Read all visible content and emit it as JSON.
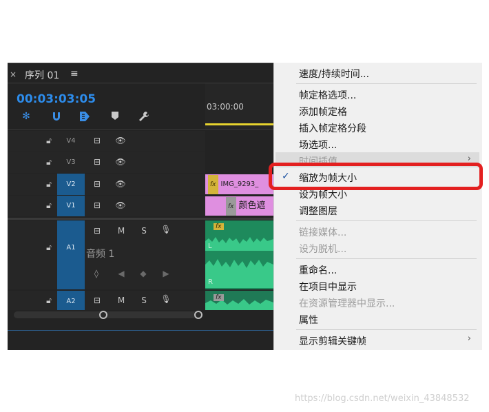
{
  "sequence": {
    "close_symbol": "×",
    "title": "序列 01",
    "menu_symbol": "≡",
    "timecode": "00:03:03:05",
    "ruler_time": "03:00:00"
  },
  "tracks": {
    "video": [
      {
        "label": "V4",
        "active": false
      },
      {
        "label": "V3",
        "active": false
      },
      {
        "label": "V2",
        "active": true
      },
      {
        "label": "V1",
        "active": true
      }
    ],
    "audio": [
      {
        "label": "A1",
        "name": "音频 1",
        "mute": "M",
        "solo": "S"
      },
      {
        "label": "A2",
        "mute": "M",
        "solo": "S"
      }
    ]
  },
  "clips": {
    "v2_fx": "fx",
    "v2_name": "IMG_9293_",
    "v1_fx": "fx",
    "v1_name": "颜色遮",
    "a1_fx": "fx",
    "a1_left": "L",
    "a1_right": "R",
    "a2_fx": "fx"
  },
  "menu": {
    "items": [
      {
        "label": "速度/持续时间...",
        "enabled": true
      },
      {
        "label": "帧定格选项...",
        "enabled": true
      },
      {
        "label": "添加帧定格",
        "enabled": true
      },
      {
        "label": "插入帧定格分段",
        "enabled": true
      },
      {
        "label": "场选项...",
        "enabled": true
      },
      {
        "label": "时间插值",
        "enabled": false,
        "submenu": true
      },
      {
        "label": "缩放为帧大小",
        "enabled": true,
        "checked": true
      },
      {
        "label": "设为帧大小",
        "enabled": true
      },
      {
        "label": "调整图层",
        "enabled": true
      },
      {
        "label": "链接媒体...",
        "enabled": false
      },
      {
        "label": "设为脱机...",
        "enabled": false
      },
      {
        "label": "重命名...",
        "enabled": true
      },
      {
        "label": "在项目中显示",
        "enabled": true
      },
      {
        "label": "在资源管理器中显示...",
        "enabled": false
      },
      {
        "label": "属性",
        "enabled": true
      },
      {
        "label": "显示剪辑关键帧",
        "enabled": true,
        "submenu": true
      }
    ],
    "check_symbol": "✓",
    "submenu_arrow": "›"
  },
  "colors": {
    "highlight_box": "#e32020",
    "timecode": "#2d8ceb",
    "clip_video": "#df8fe0",
    "clip_audio": "#1e8a5c"
  },
  "watermark": "https://blog.csdn.net/weixin_43848532"
}
